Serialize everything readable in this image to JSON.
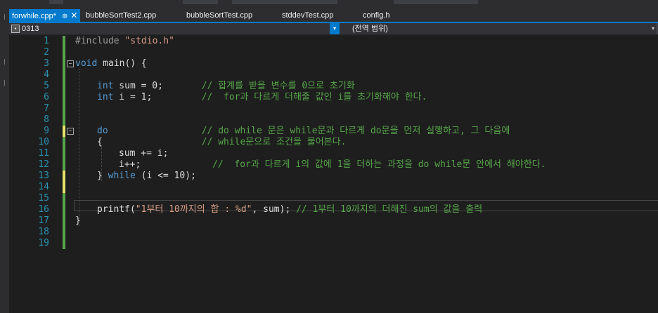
{
  "tabs": [
    {
      "label": "forwhile.cpp*",
      "active": true
    },
    {
      "label": "bubbleSortTest2.cpp"
    },
    {
      "label": "bubbleSortTest.cpp"
    },
    {
      "label": "stddevTest.cpp"
    },
    {
      "label": "config.h"
    }
  ],
  "tab_icons": {
    "pin": "⊕",
    "close": "✕"
  },
  "navbar": {
    "scope_value": "0313",
    "member_value": "(전역 범위)"
  },
  "colors": {
    "accent": "#007acc",
    "keyword": "#569cd6",
    "string": "#d69d85",
    "comment": "#57a64a",
    "line_number": "#2b91af",
    "changed_saved": "#57a64a",
    "changed_unsaved": "#e8e26b"
  },
  "code_lines": [
    {
      "n": "1",
      "change": "saved",
      "indent": 0,
      "segs": [
        {
          "t": "#include ",
          "c": "pre"
        },
        {
          "t": "\"stdio.h\"",
          "c": "str"
        }
      ]
    },
    {
      "n": "2",
      "change": "saved",
      "indent": 0,
      "segs": []
    },
    {
      "n": "3",
      "change": "saved",
      "indent": 0,
      "fold": "⊟",
      "segs": [
        {
          "t": "void",
          "c": "kw"
        },
        {
          "t": " main() {",
          "c": "pl"
        }
      ]
    },
    {
      "n": "4",
      "change": "saved",
      "indent": 0,
      "segs": []
    },
    {
      "n": "5",
      "change": "saved",
      "indent": 1,
      "segs": [
        {
          "t": "int",
          "c": "kw"
        },
        {
          "t": " sum = 0;       ",
          "c": "pl"
        },
        {
          "t": "// 합계를 받을 변수를 0으로 초기화",
          "c": "cmt"
        }
      ]
    },
    {
      "n": "6",
      "change": "saved",
      "indent": 1,
      "segs": [
        {
          "t": "int",
          "c": "kw"
        },
        {
          "t": " i = 1;         ",
          "c": "pl"
        },
        {
          "t": "//  for과 다르게 더해줄 값인 i를 초기화해야 한다.",
          "c": "cmt"
        }
      ]
    },
    {
      "n": "7",
      "change": "saved",
      "indent": 0,
      "segs": []
    },
    {
      "n": "8",
      "change": "saved",
      "indent": 0,
      "segs": []
    },
    {
      "n": "9",
      "change": "unsaved",
      "indent": 1,
      "fold": "⊟",
      "segs": [
        {
          "t": "do",
          "c": "kw"
        },
        {
          "t": "                 ",
          "c": "pl"
        },
        {
          "t": "// do while 문은 while문과 다르게 do문을 먼저 실행하고, 그 다음에",
          "c": "cmt"
        }
      ]
    },
    {
      "n": "10",
      "change": "saved",
      "indent": 1,
      "segs": [
        {
          "t": "{                  ",
          "c": "pl"
        },
        {
          "t": "// while문으로 조건을 물어본다.",
          "c": "cmt"
        }
      ]
    },
    {
      "n": "11",
      "change": "saved",
      "indent": 2,
      "segs": [
        {
          "t": "sum += i;",
          "c": "pl"
        }
      ]
    },
    {
      "n": "12",
      "change": "saved",
      "indent": 2,
      "segs": [
        {
          "t": "i++;             ",
          "c": "pl"
        },
        {
          "t": "//  for과 다르게 i의 값에 1을 더하는 과정을 do while문 안에서 해야한다.",
          "c": "cmt"
        }
      ]
    },
    {
      "n": "13",
      "change": "unsaved",
      "indent": 1,
      "segs": [
        {
          "t": "} ",
          "c": "pl"
        },
        {
          "t": "while",
          "c": "kw"
        },
        {
          "t": " (i <= 10);",
          "c": "pl"
        }
      ]
    },
    {
      "n": "14",
      "change": "unsaved",
      "indent": 0,
      "segs": []
    },
    {
      "n": "15",
      "change": "saved",
      "indent": 0,
      "current": true,
      "segs": []
    },
    {
      "n": "16",
      "change": "saved",
      "indent": 1,
      "segs": [
        {
          "t": "printf(",
          "c": "pl"
        },
        {
          "t": "\"1부터 10까지의 합 : %d\"",
          "c": "str"
        },
        {
          "t": ", sum); ",
          "c": "pl"
        },
        {
          "t": "// 1부터 10까지의 더해진 sum의 값을 출력",
          "c": "cmt"
        }
      ]
    },
    {
      "n": "17",
      "change": "saved",
      "indent": 0,
      "segs": [
        {
          "t": "}",
          "c": "pl"
        }
      ]
    },
    {
      "n": "18",
      "change": "saved",
      "indent": 0,
      "segs": []
    },
    {
      "n": "19",
      "change": "saved",
      "indent": 0,
      "segs": []
    }
  ]
}
